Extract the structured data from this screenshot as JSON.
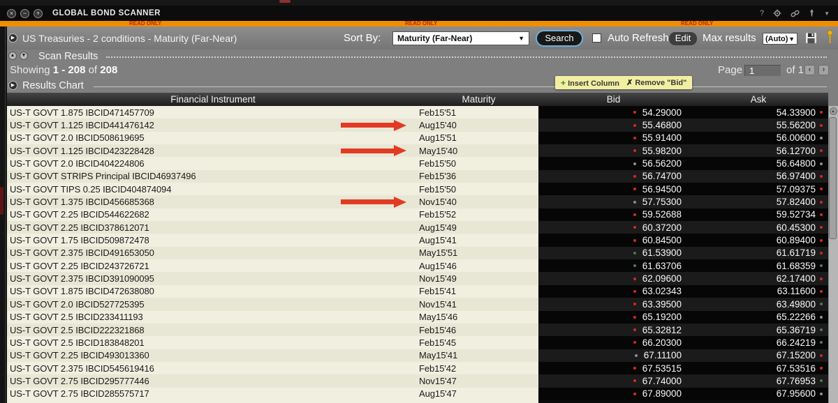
{
  "window": {
    "title": "GLOBAL BOND SCANNER",
    "controls": {
      "close": "×",
      "minimize": "−",
      "maximize": "+"
    },
    "help_icon": "?",
    "caret": "▼",
    "read_only_label": "READ ONLY"
  },
  "toolbar": {
    "scanner_label": "US Treasuries - 2 conditions - Maturity (Far-Near)",
    "sort_by_label": "Sort By:",
    "sort_by_value": "Maturity (Far-Near)",
    "search_label": "Search",
    "auto_refresh_label": "Auto Refresh",
    "edit_label": "Edit",
    "max_results_label": "Max results",
    "max_results_value": "(Auto)"
  },
  "scan_results": {
    "section_label": "Scan Results",
    "showing_prefix": "Showing",
    "showing_range": "1 - 208",
    "of_label": "of",
    "showing_total": "208",
    "page_label": "Page",
    "page_value": "1",
    "page_of": "of 1",
    "prev_glyph": "‹",
    "next_glyph": "›"
  },
  "results_chart": {
    "section_label": "Results Chart"
  },
  "tooltip": {
    "insert_label": "Insert Column",
    "remove_label": "Remove \"Bid\"",
    "plus_glyph": "+",
    "x_glyph": "✗"
  },
  "table": {
    "columns": [
      "Financial Instrument",
      "Maturity",
      "Bid",
      "Ask"
    ],
    "rows": [
      {
        "instrument": "US-T GOVT 1.875 IBCID471457709",
        "maturity": "Feb15'51",
        "bid": "54.29000",
        "ask": "54.33900",
        "arrow": false,
        "bid_dot": "red",
        "ask_dot": "red"
      },
      {
        "instrument": "US-T GOVT 1.125 IBCID441476142",
        "maturity": "Aug15'40",
        "bid": "55.46800",
        "ask": "55.56200",
        "arrow": true,
        "bid_dot": "red",
        "ask_dot": "red"
      },
      {
        "instrument": "US-T GOVT 2.0 IBCID508619695",
        "maturity": "Aug15'51",
        "bid": "55.91400",
        "ask": "56.00600",
        "arrow": false,
        "bid_dot": "red",
        "ask_dot": "gray"
      },
      {
        "instrument": "US-T GOVT 1.125 IBCID423228428",
        "maturity": "May15'40",
        "bid": "55.98200",
        "ask": "56.12700",
        "arrow": true,
        "bid_dot": "red",
        "ask_dot": "red"
      },
      {
        "instrument": "US-T GOVT 2.0 IBCID404224806",
        "maturity": "Feb15'50",
        "bid": "56.56200",
        "ask": "56.64800",
        "arrow": false,
        "bid_dot": "gray",
        "ask_dot": "gray"
      },
      {
        "instrument": "US-T GOVT STRIPS Principal IBCID46937496",
        "maturity": "Feb15'36",
        "bid": "56.74700",
        "ask": "56.97400",
        "arrow": false,
        "bid_dot": "red",
        "ask_dot": "red"
      },
      {
        "instrument": "US-T GOVT TIPS 0.25 IBCID404874094",
        "maturity": "Feb15'50",
        "bid": "56.94500",
        "ask": "57.09375",
        "arrow": false,
        "bid_dot": "red",
        "ask_dot": "red"
      },
      {
        "instrument": "US-T GOVT 1.375 IBCID456685368",
        "maturity": "Nov15'40",
        "bid": "57.75300",
        "ask": "57.82400",
        "arrow": true,
        "bid_dot": "gray",
        "ask_dot": "red"
      },
      {
        "instrument": "US-T GOVT 2.25 IBCID544622682",
        "maturity": "Feb15'52",
        "bid": "59.52688",
        "ask": "59.52734",
        "arrow": false,
        "bid_dot": "red",
        "ask_dot": "red"
      },
      {
        "instrument": "US-T GOVT 2.25 IBCID378612071",
        "maturity": "Aug15'49",
        "bid": "60.37200",
        "ask": "60.45300",
        "arrow": false,
        "bid_dot": "red",
        "ask_dot": "red"
      },
      {
        "instrument": "US-T GOVT 1.75 IBCID509872478",
        "maturity": "Aug15'41",
        "bid": "60.84500",
        "ask": "60.89400",
        "arrow": false,
        "bid_dot": "red",
        "ask_dot": "red"
      },
      {
        "instrument": "US-T GOVT 2.375 IBCID491653050",
        "maturity": "May15'51",
        "bid": "61.53900",
        "ask": "61.61719",
        "arrow": false,
        "bid_dot": "green",
        "ask_dot": "red"
      },
      {
        "instrument": "US-T GOVT 2.25 IBCID243726721",
        "maturity": "Aug15'46",
        "bid": "61.63706",
        "ask": "61.68359",
        "arrow": false,
        "bid_dot": "green",
        "ask_dot": "green"
      },
      {
        "instrument": "US-T GOVT 2.375 IBCID391090095",
        "maturity": "Nov15'49",
        "bid": "62.09600",
        "ask": "62.17400",
        "arrow": false,
        "bid_dot": "red",
        "ask_dot": "red"
      },
      {
        "instrument": "US-T GOVT 1.875 IBCID472638080",
        "maturity": "Feb15'41",
        "bid": "63.02343",
        "ask": "63.11600",
        "arrow": false,
        "bid_dot": "red",
        "ask_dot": "red"
      },
      {
        "instrument": "US-T GOVT 2.0 IBCID527725395",
        "maturity": "Nov15'41",
        "bid": "63.39500",
        "ask": "63.49800",
        "arrow": false,
        "bid_dot": "red",
        "ask_dot": "green"
      },
      {
        "instrument": "US-T GOVT 2.5 IBCID233411193",
        "maturity": "May15'46",
        "bid": "65.19200",
        "ask": "65.22266",
        "arrow": false,
        "bid_dot": "red",
        "ask_dot": "gray"
      },
      {
        "instrument": "US-T GOVT 2.5 IBCID222321868",
        "maturity": "Feb15'46",
        "bid": "65.32812",
        "ask": "65.36719",
        "arrow": false,
        "bid_dot": "red",
        "ask_dot": "green"
      },
      {
        "instrument": "US-T GOVT 2.5 IBCID183848201",
        "maturity": "Feb15'45",
        "bid": "66.20300",
        "ask": "66.24219",
        "arrow": false,
        "bid_dot": "red",
        "ask_dot": "green"
      },
      {
        "instrument": "US-T GOVT 2.25 IBCID493013360",
        "maturity": "May15'41",
        "bid": "67.11100",
        "ask": "67.15200",
        "arrow": false,
        "bid_dot": "gray",
        "ask_dot": "red"
      },
      {
        "instrument": "US-T GOVT 2.375 IBCID545619416",
        "maturity": "Feb15'42",
        "bid": "67.53515",
        "ask": "67.53516",
        "arrow": false,
        "bid_dot": "red",
        "ask_dot": "red"
      },
      {
        "instrument": "US-T GOVT 2.75 IBCID295777446",
        "maturity": "Nov15'47",
        "bid": "67.74000",
        "ask": "67.76953",
        "arrow": false,
        "bid_dot": "red",
        "ask_dot": "green"
      },
      {
        "instrument": "US-T GOVT 2.75 IBCID285575717",
        "maturity": "Aug15'47",
        "bid": "67.89000",
        "ask": "67.95600",
        "arrow": false,
        "bid_dot": "red",
        "ask_dot": "gray"
      }
    ]
  },
  "colors": {
    "accent_orange": "#ef8e00",
    "read_only_red": "#c22800",
    "arrow_red": "#e23b24",
    "dots": {
      "red": "#d22a1e",
      "gray": "#8f8f8f",
      "green": "#4e7a4e"
    }
  }
}
